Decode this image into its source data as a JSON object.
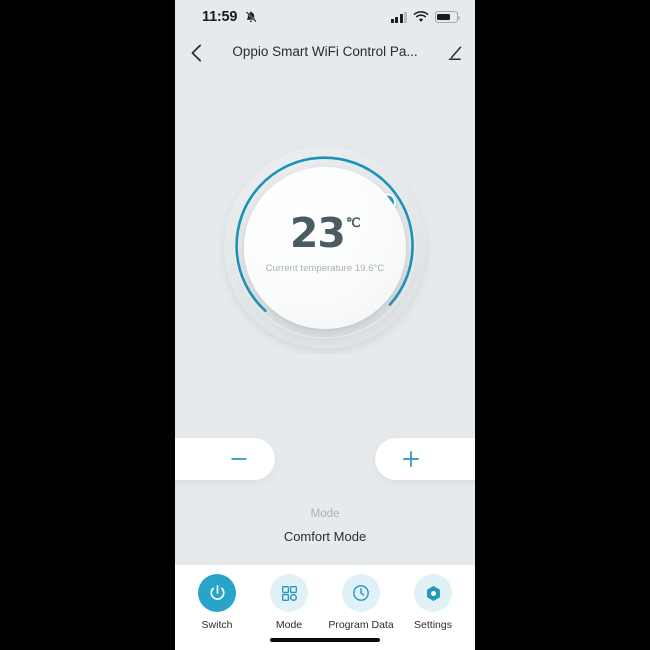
{
  "accent_color": "#28a4c9",
  "screen_bg": "#e6eaec",
  "status_bar": {
    "time": "11:59",
    "bell_icon": "bell-muted-icon",
    "signal_icon": "cellular-signal-icon",
    "signal_bars_filled": 3,
    "signal_bars_total": 4,
    "wifi_icon": "wifi-icon",
    "battery_icon": "battery-icon",
    "battery_level_pct": 60
  },
  "title_bar": {
    "back_icon": "chevron-left-icon",
    "title": "Oppio Smart WiFi Control Pa...",
    "edit_icon": "pencil-edit-icon"
  },
  "dial": {
    "set_temperature": "23",
    "unit": "℃",
    "current_temperature_text": "Current temperature 19.6°C",
    "arc_color": "#1b93b8",
    "track_color": "#e4e7e9",
    "knob_icon": "dial-knob-handle",
    "arc_start_deg": 135,
    "arc_sweep_deg": 200
  },
  "controls": {
    "decrease_label": "−",
    "decrease_icon": "minus-icon",
    "increase_label": "+",
    "increase_icon": "plus-icon"
  },
  "mode": {
    "label": "Mode",
    "value": "Comfort  Mode"
  },
  "bottom_nav": {
    "items": [
      {
        "label": "Switch",
        "icon": "power-icon",
        "active": true
      },
      {
        "label": "Mode",
        "icon": "grid-icon",
        "active": false
      },
      {
        "label": "Program Data",
        "icon": "clock-icon",
        "active": false
      },
      {
        "label": "Settings",
        "icon": "hex-gear-icon",
        "active": false
      }
    ],
    "home_indicator": "home-indicator-bar"
  }
}
